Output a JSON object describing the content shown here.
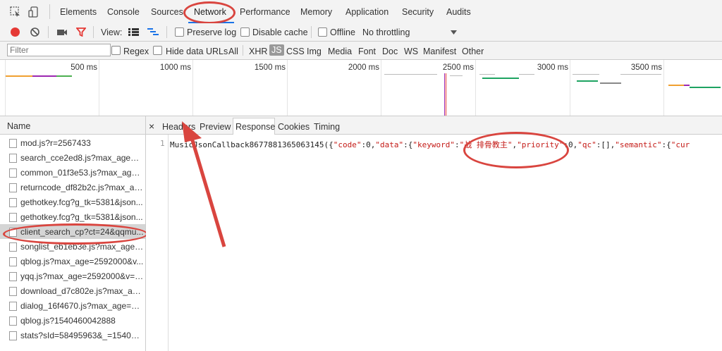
{
  "tabs": [
    "Elements",
    "Console",
    "Sources",
    "Network",
    "Performance",
    "Memory",
    "Application",
    "Security",
    "Audits"
  ],
  "toolbar": {
    "view_label": "View:",
    "preserve_log": "Preserve log",
    "disable_cache": "Disable cache",
    "offline": "Offline",
    "throttling": "No throttling"
  },
  "filter": {
    "placeholder": "Filter",
    "regex": "Regex",
    "hide_data_urls": "Hide data URLs",
    "types": [
      "All",
      "XHR",
      "JS",
      "CSS",
      "Img",
      "Media",
      "Font",
      "Doc",
      "WS",
      "Manifest",
      "Other"
    ],
    "selected_type": "JS"
  },
  "overview": {
    "ticks": [
      "500 ms",
      "1000 ms",
      "1500 ms",
      "2000 ms",
      "2500 ms",
      "3000 ms",
      "3500 ms"
    ]
  },
  "names": {
    "header": "Name",
    "rows": [
      "mod.js?r=2567433",
      "search_cce2ed8.js?max_age=31...",
      "common_01f3e53.js?max_age=...",
      "returncode_df82b2c.js?max_ag...",
      "gethotkey.fcg?g_tk=5381&json...",
      "gethotkey.fcg?g_tk=5381&json...",
      "client_search_cp?ct=24&qqmu...",
      "songlist_eb1eb3e.js?max_age=...",
      "qblog.js?max_age=2592000&v...",
      "yqq.js?max_age=2592000&v=2...",
      "download_d7c802e.js?max_age...",
      "dialog_16f4670.js?max_age=31...",
      "qblog.js?1540460042888",
      "stats?sId=58495963&_=1540460..."
    ],
    "selected_index": 6
  },
  "detail": {
    "close": "×",
    "tabs": [
      "Headers",
      "Preview",
      "Response",
      "Cookies",
      "Timing"
    ],
    "selected_tab": "Response",
    "line_number": "1",
    "code_prefix": "MusicJsonCallback8677881365063145({",
    "code_parts": [
      {
        "t": "\"code\"",
        "c": "str"
      },
      {
        "t": ":0,",
        "c": ""
      },
      {
        "t": "\"data\"",
        "c": "str"
      },
      {
        "t": ":{",
        "c": ""
      },
      {
        "t": "\"keyword\"",
        "c": "str"
      },
      {
        "t": ":",
        "c": ""
      },
      {
        "t": "\"战 排骨教主\"",
        "c": "str"
      },
      {
        "t": ",",
        "c": ""
      },
      {
        "t": "\"priority\"",
        "c": "str"
      },
      {
        "t": ":0,",
        "c": ""
      },
      {
        "t": "\"qc\"",
        "c": "str"
      },
      {
        "t": ":[],",
        "c": ""
      },
      {
        "t": "\"semantic\"",
        "c": "str"
      },
      {
        "t": ":{",
        "c": ""
      },
      {
        "t": "\"cur",
        "c": "str"
      }
    ]
  },
  "colors": {
    "annotation": "#d9453f",
    "selected_row": "#d5d5d5",
    "accent": "#1a73e8"
  }
}
